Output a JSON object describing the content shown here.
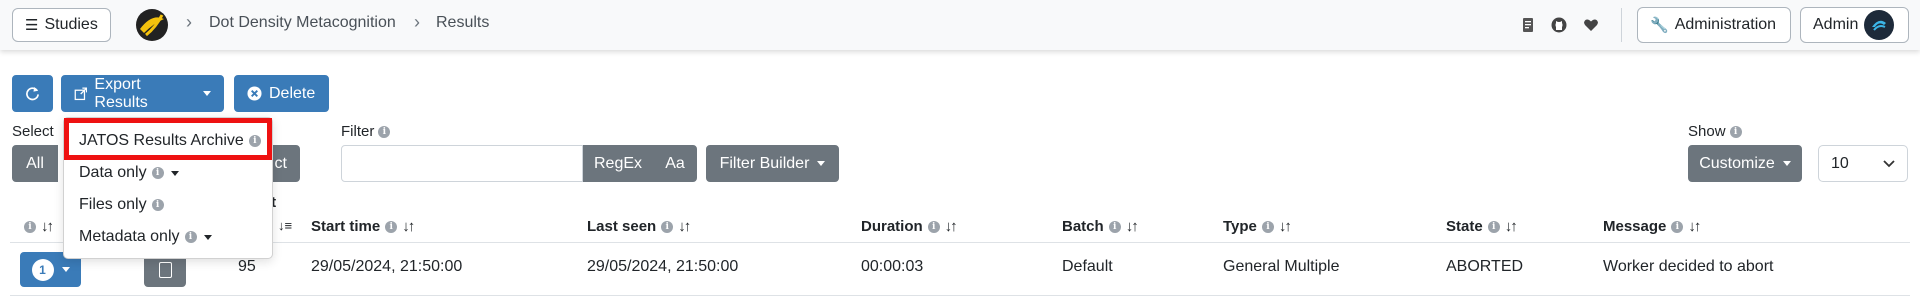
{
  "topbar": {
    "studies_label": "Studies",
    "breadcrumb": [
      "Dot Density Metacognition",
      "Results"
    ],
    "administration_label": "Administration",
    "user_label": "Admin"
  },
  "toolbar": {
    "export_label": "Export Results",
    "delete_label": "Delete"
  },
  "export_menu": {
    "items": [
      "JATOS Results Archive",
      "Data only",
      "Files only",
      "Metadata only"
    ]
  },
  "select": {
    "label": "Select",
    "all_label": "All",
    "deselect_tail": "ct"
  },
  "filter": {
    "label": "Filter",
    "value": "",
    "regex_label": "RegEx",
    "case_label": "Aa",
    "builder_label": "Filter Builder"
  },
  "show": {
    "label": "Show",
    "customize_label": "Customize",
    "page_size": "10"
  },
  "table": {
    "header_partial": "lt",
    "columns": [
      "Start time",
      "Last seen",
      "Duration",
      "Batch",
      "Type",
      "State",
      "Message"
    ],
    "rows": [
      {
        "badge": "1",
        "id": "95",
        "start_time": "29/05/2024, 21:50:00",
        "last_seen": "29/05/2024, 21:50:00",
        "duration": "00:00:03",
        "batch": "Default",
        "type": "General Multiple",
        "state": "ABORTED",
        "message": "Worker decided to abort"
      }
    ]
  },
  "colors": {
    "primary": "#3a7bb8",
    "secondary": "#6c757d",
    "highlight": "#ee1111"
  }
}
